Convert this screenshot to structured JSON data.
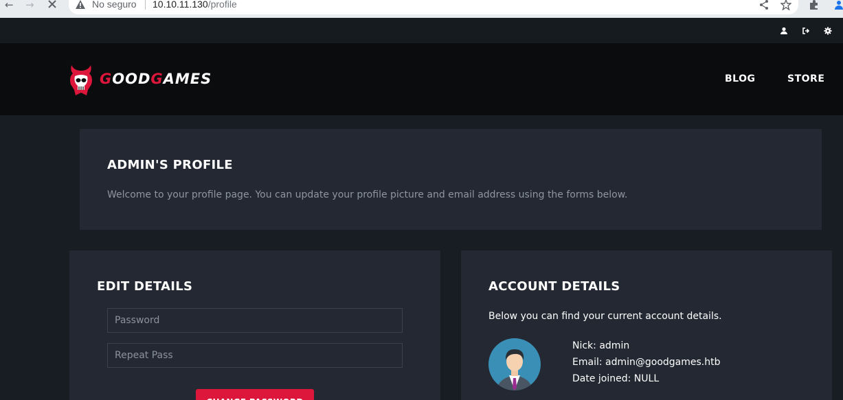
{
  "browser": {
    "security_label": "No seguro",
    "url_host": "10.10.11.130",
    "url_path": "/profile"
  },
  "topbar": {
    "icons": [
      "user-icon",
      "sign-out-icon",
      "gear-icon"
    ]
  },
  "header": {
    "logo_part1": "G",
    "logo_part2": "OOD",
    "logo_part3": "G",
    "logo_part4": "AMES",
    "nav": [
      "BLOG",
      "STORE"
    ]
  },
  "intro": {
    "title": "ADMIN'S PROFILE",
    "text": "Welcome to your profile page. You can update your profile picture and email address using the forms below."
  },
  "edit": {
    "title": "EDIT DETAILS",
    "password_placeholder": "Password",
    "repeat_placeholder": "Repeat Pass",
    "button": "CHANGE PASSWORD"
  },
  "account": {
    "title": "ACCOUNT DETAILS",
    "subtitle": "Below you can find your current account details.",
    "nick": "Nick: admin",
    "email": "Email: admin@goodgames.htb",
    "joined": "Date joined: NULL"
  },
  "colors": {
    "accent": "#dd163b",
    "panel": "#232832",
    "background": "#171d22"
  }
}
